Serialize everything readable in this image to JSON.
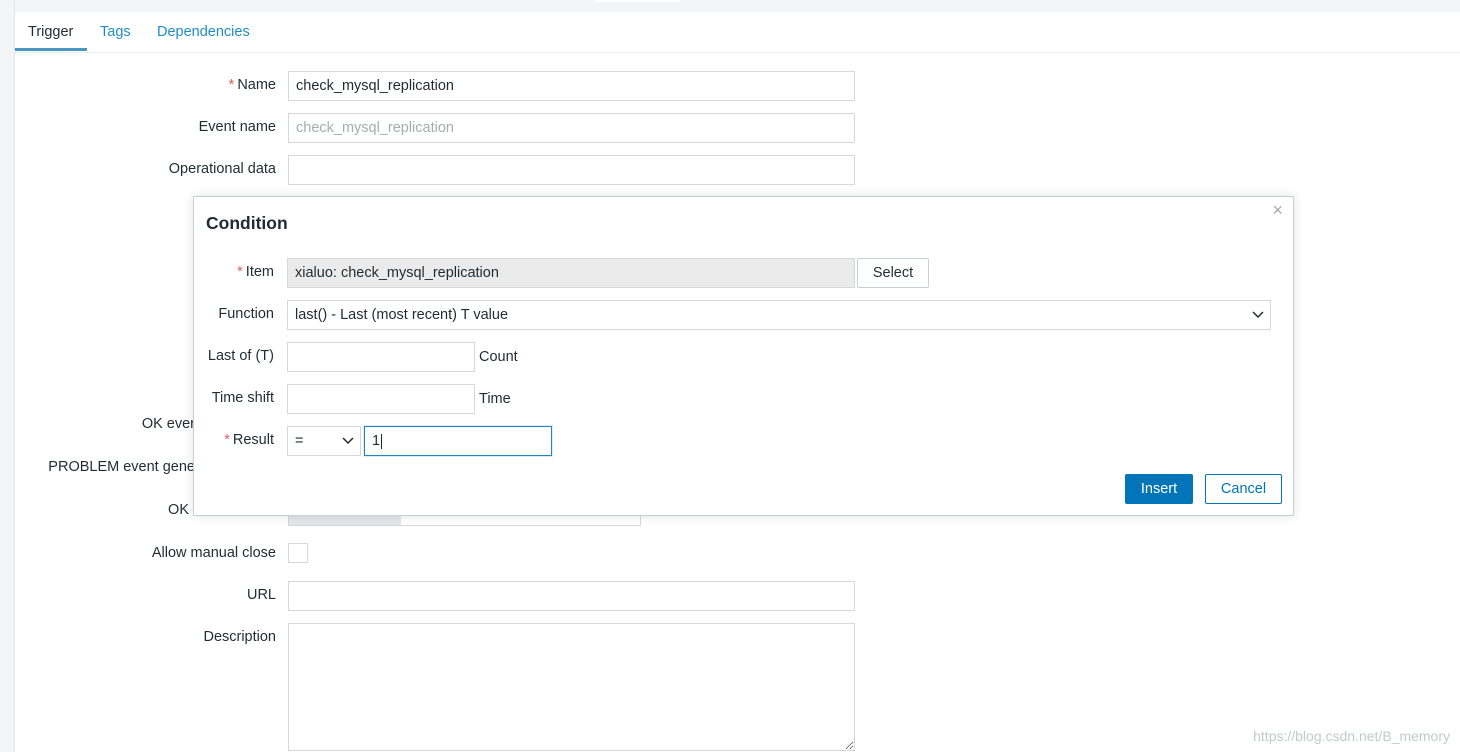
{
  "tabs": [
    {
      "label": "Trigger",
      "active": true
    },
    {
      "label": "Tags",
      "active": false
    },
    {
      "label": "Dependencies",
      "active": false
    }
  ],
  "form": {
    "name_label": "Name",
    "name_value": "check_mysql_replication",
    "event_name_label": "Event name",
    "event_name_placeholder": "check_mysql_replication",
    "operational_data_label": "Operational data",
    "operational_data_value": "",
    "ok_event_label": "OK ever",
    "problem_event_label": "PROBLEM event gene",
    "ok_label": "OK",
    "allow_manual_close_label": "Allow manual close",
    "url_label": "URL",
    "url_value": "",
    "description_label": "Description",
    "description_value": ""
  },
  "dialog": {
    "title": "Condition",
    "close_symbol": "×",
    "item_label": "Item",
    "item_value": "xialuo: check_mysql_replication",
    "select_button": "Select",
    "function_label": "Function",
    "function_value": "last() - Last (most recent) T value",
    "last_of_label": "Last of (T)",
    "last_of_value": "",
    "last_of_unit": "Count",
    "time_shift_label": "Time shift",
    "time_shift_value": "",
    "time_shift_unit": "Time",
    "result_label": "Result",
    "result_operator": "=",
    "result_value": "1",
    "insert_button": "Insert",
    "cancel_button": "Cancel"
  },
  "required_marker": "*",
  "icons": {
    "close": "close-icon",
    "chevron": "chevron-down-icon"
  },
  "colors": {
    "link": "#1f8dc6",
    "primary": "#0275b8",
    "required": "#e45959",
    "readonly_bg": "#ebebeb"
  },
  "watermark": "https://blog.csdn.net/B_memory"
}
